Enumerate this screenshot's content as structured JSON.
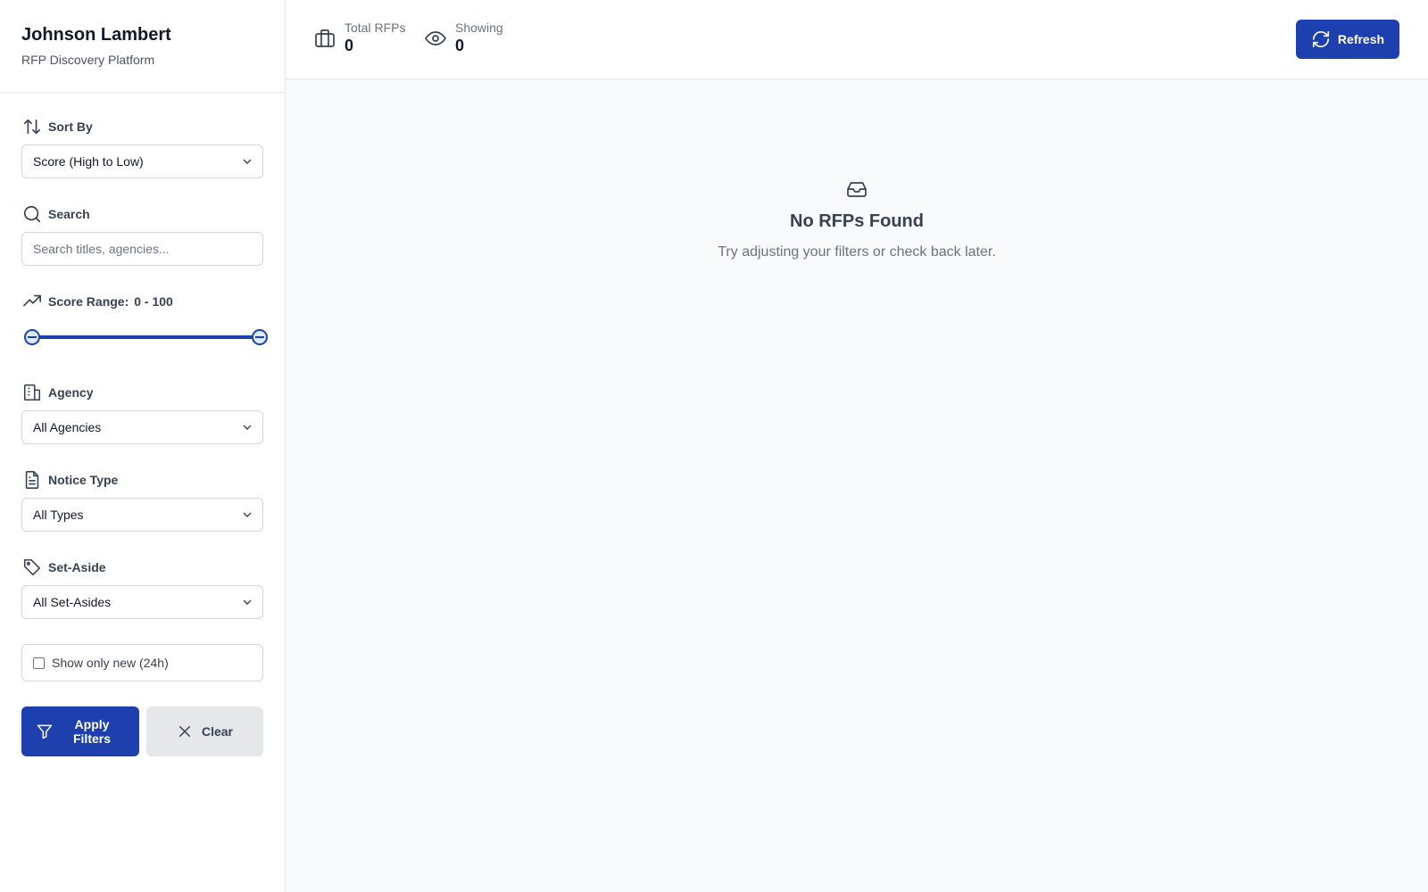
{
  "brand": {
    "title": "Johnson Lambert",
    "subtitle": "RFP Discovery Platform"
  },
  "filters": {
    "sort": {
      "label": "Sort By",
      "value": "Score (High to Low)"
    },
    "search": {
      "label": "Search",
      "placeholder": "Search titles, agencies..."
    },
    "score_range": {
      "label": "Score Range:",
      "display": "0 - 100",
      "min": 0,
      "max": 100,
      "low": 0,
      "high": 100
    },
    "agency": {
      "label": "Agency",
      "value": "All Agencies"
    },
    "notice_type": {
      "label": "Notice Type",
      "value": "All Types"
    },
    "set_aside": {
      "label": "Set-Aside",
      "value": "All Set-Asides"
    },
    "new_only": {
      "label": "Show only new (24h)",
      "checked": false
    },
    "apply_label_1": "Apply",
    "apply_label_2": "Filters",
    "clear_label": "Clear"
  },
  "stats": {
    "total": {
      "label": "Total RFPs",
      "value": "0"
    },
    "showing": {
      "label": "Showing",
      "value": "0"
    }
  },
  "refresh_label": "Refresh",
  "empty": {
    "title": "No RFPs Found",
    "subtitle": "Try adjusting your filters or check back later."
  },
  "colors": {
    "primary": "#1e40af",
    "border": "#d1d5db",
    "muted": "#6b7280"
  }
}
